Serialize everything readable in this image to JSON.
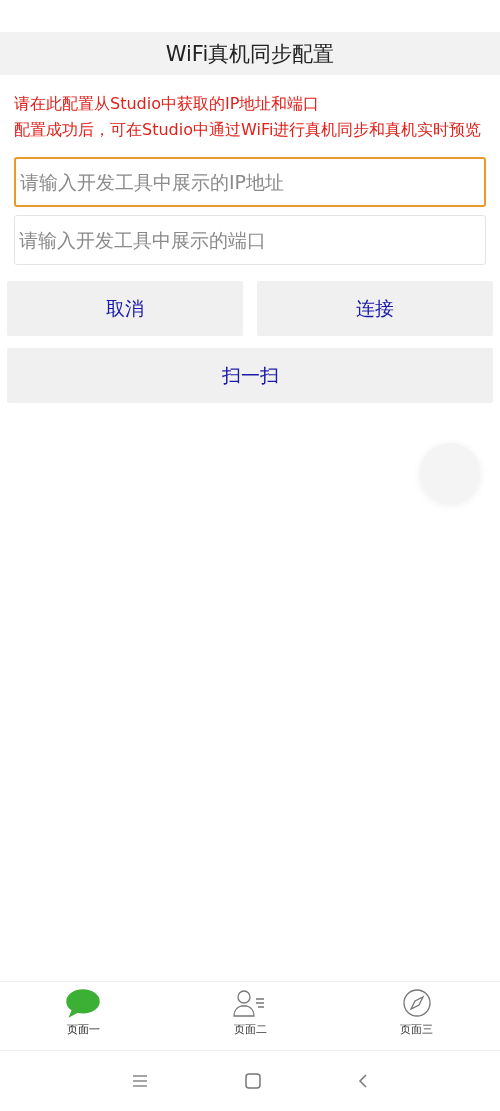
{
  "header": {
    "title": "WiFi真机同步配置"
  },
  "notice": [
    "请在此配置从Studio中获取的IP地址和端口",
    "配置成功后，可在Studio中通过WiFi进行真机同步和真机实时预览"
  ],
  "fields": [
    {
      "placeholder": "请输入开发工具中展示的IP地址",
      "focused": true
    },
    {
      "placeholder": "请输入开发工具中展示的端口",
      "focused": false
    }
  ],
  "buttons": [
    {
      "label": "取消"
    },
    {
      "label": "连接"
    }
  ],
  "scan_button": {
    "label": "扫一扫"
  },
  "tabs": [
    {
      "label": "页面一",
      "kind": "chat",
      "selected": true
    },
    {
      "label": "页面二",
      "kind": "contacts",
      "selected": false
    },
    {
      "label": "页面三",
      "kind": "compass",
      "selected": false
    }
  ]
}
